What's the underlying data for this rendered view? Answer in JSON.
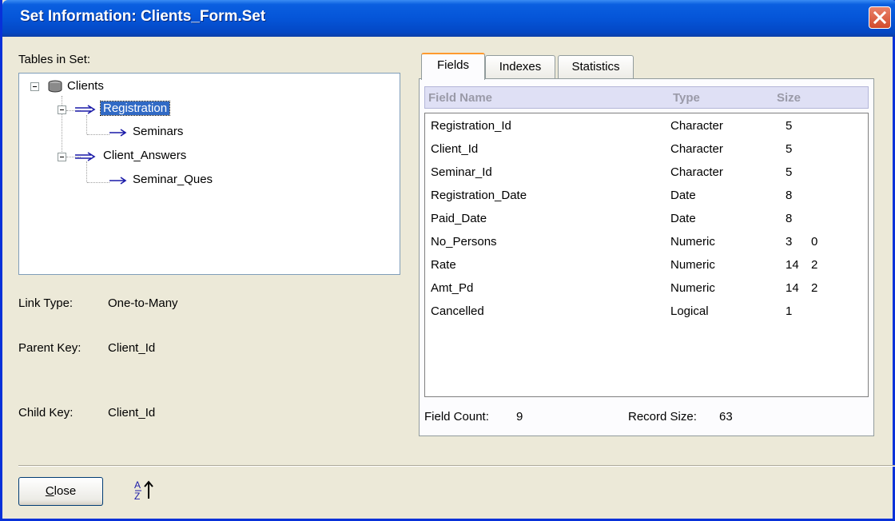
{
  "window": {
    "title": "Set Information: Clients_Form.Set"
  },
  "tree": {
    "caption": "Tables in Set:",
    "nodes": [
      {
        "label": "Clients",
        "icon": "database-icon",
        "level": 0
      },
      {
        "label": "Registration",
        "icon": "link-arrow-icon",
        "level": 1,
        "selected": true
      },
      {
        "label": "Seminars",
        "icon": "link-arrow-icon",
        "level": 2
      },
      {
        "label": "Client_Answers",
        "icon": "link-arrow-icon",
        "level": 1
      },
      {
        "label": "Seminar_Ques",
        "icon": "link-arrow-icon",
        "level": 2
      }
    ]
  },
  "details": {
    "link_type_label": "Link Type:",
    "link_type_value": "One-to-Many",
    "parent_key_label": "Parent Key:",
    "parent_key_value": "Client_Id",
    "child_key_label": "Child Key:",
    "child_key_value": "Client_Id"
  },
  "tabs": [
    {
      "label": "Fields",
      "active": true
    },
    {
      "label": "Indexes",
      "active": false
    },
    {
      "label": "Statistics",
      "active": false
    }
  ],
  "fields": {
    "columns": [
      "Field Name",
      "Type",
      "Size"
    ],
    "rows": [
      {
        "name": "Registration_Id",
        "type": "Character",
        "size": "5",
        "dec": ""
      },
      {
        "name": "Client_Id",
        "type": "Character",
        "size": "5",
        "dec": ""
      },
      {
        "name": "Seminar_Id",
        "type": "Character",
        "size": "5",
        "dec": ""
      },
      {
        "name": "Registration_Date",
        "type": "Date",
        "size": "8",
        "dec": ""
      },
      {
        "name": "Paid_Date",
        "type": "Date",
        "size": "8",
        "dec": ""
      },
      {
        "name": "No_Persons",
        "type": "Numeric",
        "size": "3",
        "dec": "0"
      },
      {
        "name": "Rate",
        "type": "Numeric",
        "size": "14",
        "dec": "2"
      },
      {
        "name": "Amt_Pd",
        "type": "Numeric",
        "size": "14",
        "dec": "2"
      },
      {
        "name": "Cancelled",
        "type": "Logical",
        "size": "1",
        "dec": ""
      }
    ],
    "field_count_label": "Field Count:",
    "field_count": "9",
    "record_size_label": "Record Size:",
    "record_size": "63"
  },
  "buttons": {
    "close_label": "Close",
    "close_mnemonic": "C",
    "close_rest": "lose"
  },
  "colors": {
    "titlebar": "#0555d8",
    "selection": "#316ac5",
    "grid_header": "#dfe0f5"
  }
}
